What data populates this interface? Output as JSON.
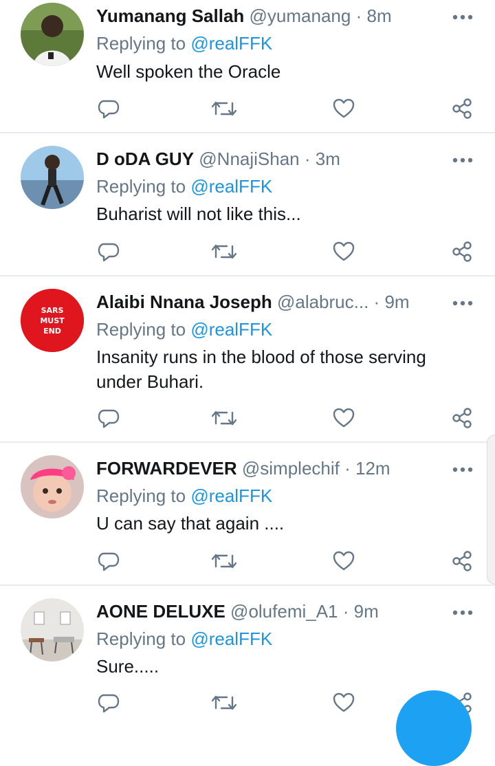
{
  "tweets": [
    {
      "name": "Yumanang Sallah",
      "handle": "@yumanang",
      "sep": "·",
      "time": "8m",
      "reply_prefix": "Replying to",
      "reply_to": "@realFFK",
      "text": "Well spoken the Oracle"
    },
    {
      "name": "D oDA GUY",
      "handle": "@NnajiShan",
      "sep": "·",
      "time": "3m",
      "reply_prefix": "Replying to",
      "reply_to": "@realFFK",
      "text": "Buharist will not like this..."
    },
    {
      "name": "Alaibi Nnana Joseph",
      "handle": "@alabruc...",
      "sep": "·",
      "time": "9m",
      "reply_prefix": "Replying to",
      "reply_to": "@realFFK",
      "text": "Insanity runs in the blood of those serving under Buhari.",
      "avatar_text": [
        "SARS",
        "MUST",
        "END"
      ]
    },
    {
      "name": "FORWARDEVER",
      "handle": "@simplechif",
      "sep": "·",
      "time": "12m",
      "reply_prefix": "Replying to",
      "reply_to": "@realFFK",
      "text": "U can say that again ...."
    },
    {
      "name": "AONE DELUXE",
      "handle": "@olufemi_A1",
      "sep": "·",
      "time": "9m",
      "reply_prefix": "Replying to",
      "reply_to": "@realFFK",
      "text": "Sure....."
    }
  ],
  "icons": {
    "more": "more-icon",
    "reply": "reply-icon",
    "retweet": "retweet-icon",
    "like": "like-icon",
    "share": "share-icon"
  },
  "colors": {
    "accent": "#1b95e0",
    "muted": "#657786",
    "fab": "#1da1f2",
    "avatar_red": "#e0161e"
  }
}
